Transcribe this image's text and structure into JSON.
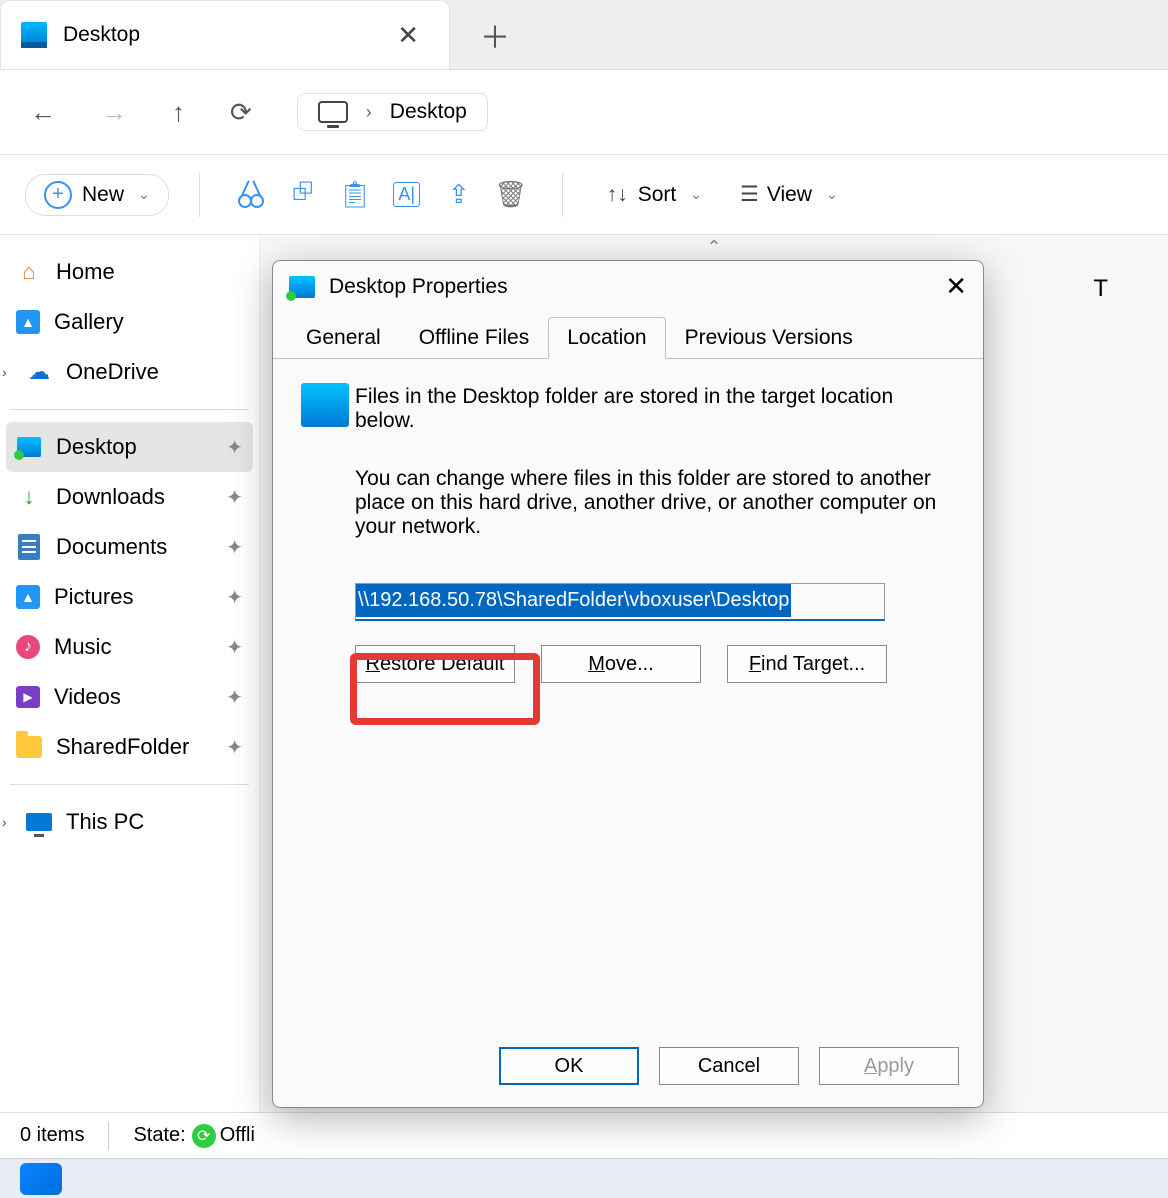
{
  "window": {
    "tab_title": "Desktop",
    "navbar_location": "Desktop",
    "toolbar": {
      "new": "New",
      "sort": "Sort",
      "view": "View"
    },
    "sidebar": {
      "home": "Home",
      "gallery": "Gallery",
      "onedrive": "OneDrive",
      "desktop": "Desktop",
      "downloads": "Downloads",
      "documents": "Documents",
      "pictures": "Pictures",
      "music": "Music",
      "videos": "Videos",
      "shared": "SharedFolder",
      "thispc": "This PC"
    },
    "status": {
      "items": "0 items",
      "state_label": "State:",
      "state_value": "Offli"
    },
    "cutoff_text": "T"
  },
  "dialog": {
    "title": "Desktop Properties",
    "tabs": {
      "general": "General",
      "offline": "Offline Files",
      "location": "Location",
      "previous": "Previous Versions"
    },
    "body": {
      "line1": "Files in the Desktop folder are stored in the target location below.",
      "line2": "You can change where files in this folder are stored to another place on this hard drive, another drive, or another computer on your network.",
      "path_value": "\\\\192.168.50.78\\SharedFolder\\vboxuser\\Desktop"
    },
    "buttons": {
      "restore": "Restore Default",
      "move": "Move...",
      "find": "Find Target...",
      "ok": "OK",
      "cancel": "Cancel",
      "apply": "Apply"
    }
  }
}
